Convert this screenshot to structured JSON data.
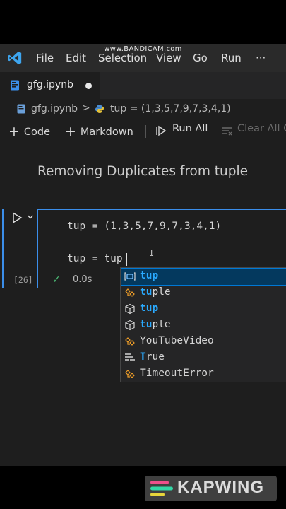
{
  "watermark": "www.BANDICAM.com",
  "menubar": {
    "items": [
      "File",
      "Edit",
      "Selection",
      "View",
      "Go",
      "Run"
    ],
    "overflow": "···"
  },
  "tab": {
    "label": "gfg.ipynb",
    "modified": true
  },
  "breadcrumb": {
    "file": "gfg.ipynb",
    "separator": ">",
    "symbol": "tup = (1,3,5,7,9,7,3,4,1)"
  },
  "toolbar": {
    "plus": "+",
    "code_label": "Code",
    "markdown_label": "Markdown",
    "run_all_label": "Run All",
    "clear_all_label": "Clear All O"
  },
  "notebook": {
    "markdown_heading": "Removing Duplicates from tuple",
    "cell": {
      "lines": [
        "tup = (1,3,5,7,9,7,3,4,1)",
        "tup = tup"
      ],
      "ibeam": "I",
      "exec_count": "[26]",
      "status_icon": "✓",
      "exec_time": "0.0s"
    }
  },
  "suggestions": [
    {
      "icon": "variable-icon",
      "pre": "",
      "hl": "tup",
      "post": "",
      "selected": true
    },
    {
      "icon": "class-icon",
      "pre": "",
      "hl": "tu",
      "post": "ple",
      "selected": false
    },
    {
      "icon": "module-icon",
      "pre": "",
      "hl": "tup",
      "post": "",
      "selected": false
    },
    {
      "icon": "module-icon",
      "pre": "",
      "hl": "tu",
      "post": "ple",
      "selected": false
    },
    {
      "icon": "class-icon",
      "pre": "YouTu",
      "hl": "",
      "post": "beVideo",
      "selected": false
    },
    {
      "icon": "keyword-icon",
      "pre": "",
      "hl": "T",
      "post": "rue",
      "selected": false
    },
    {
      "icon": "class-icon",
      "pre": "Timeo",
      "hl": "",
      "post": "utError",
      "selected": false
    }
  ],
  "branding": {
    "kapwing": "KAPWING"
  },
  "colors": {
    "accent": "#3b8eea",
    "selection": "#04395e",
    "match": "#2aaaff",
    "success": "#4ec27a"
  }
}
